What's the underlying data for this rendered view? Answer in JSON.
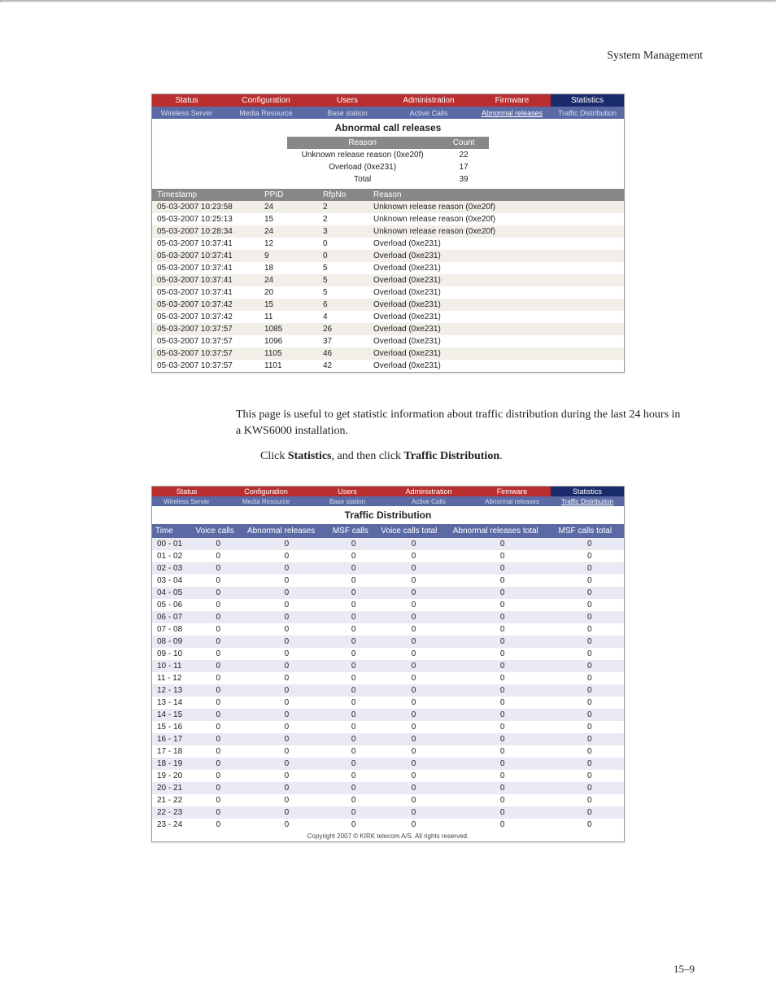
{
  "header": {
    "section": "System Management"
  },
  "shot1": {
    "tabs1": [
      "Status",
      "Configuration",
      "Users",
      "Administration",
      "Firmware",
      "Statistics"
    ],
    "tabs1_active_index": 5,
    "tabs2": [
      "Wireless Server",
      "Media Resource",
      "Base station",
      "Active Calls",
      "Abnormal releases",
      "Traffic Distribution"
    ],
    "tabs2_active_index": 4,
    "title": "Abnormal call releases",
    "sum_headers": [
      "Reason",
      "Count"
    ],
    "sum_rows": [
      [
        "Unknown release reason (0xe20f)",
        "22"
      ],
      [
        "Overload (0xe231)",
        "17"
      ],
      [
        "Total",
        "39"
      ]
    ],
    "cols": [
      "Timestamp",
      "PPID",
      "RfpNo",
      "Reason"
    ],
    "rows": [
      [
        "05-03-2007 10:23:58",
        "24",
        "2",
        "Unknown release reason (0xe20f)"
      ],
      [
        "05-03-2007 10:25:13",
        "15",
        "2",
        "Unknown release reason (0xe20f)"
      ],
      [
        "05-03-2007 10:28:34",
        "24",
        "3",
        "Unknown release reason (0xe20f)"
      ],
      [
        "05-03-2007 10:37:41",
        "12",
        "0",
        "Overload (0xe231)"
      ],
      [
        "05-03-2007 10:37:41",
        "9",
        "0",
        "Overload (0xe231)"
      ],
      [
        "05-03-2007 10:37:41",
        "18",
        "5",
        "Overload (0xe231)"
      ],
      [
        "05-03-2007 10:37:41",
        "24",
        "5",
        "Overload (0xe231)"
      ],
      [
        "05-03-2007 10:37:41",
        "20",
        "5",
        "Overload (0xe231)"
      ],
      [
        "05-03-2007 10:37:42",
        "15",
        "6",
        "Overload (0xe231)"
      ],
      [
        "05-03-2007 10:37:42",
        "11",
        "4",
        "Overload (0xe231)"
      ],
      [
        "05-03-2007 10:37:57",
        "1085",
        "26",
        "Overload (0xe231)"
      ],
      [
        "05-03-2007 10:37:57",
        "1096",
        "37",
        "Overload (0xe231)"
      ],
      [
        "05-03-2007 10:37:57",
        "1105",
        "46",
        "Overload (0xe231)"
      ],
      [
        "05-03-2007 10:37:57",
        "1101",
        "42",
        "Overload (0xe231)"
      ]
    ]
  },
  "body": {
    "para": "This page is useful to get statistic information about traffic distribution during the last 24 hours in a KWS6000 installation.",
    "step_pre": "Click ",
    "step_b1": "Statistics",
    "step_mid": ", and then click ",
    "step_b2": "Traffic Distribution",
    "step_post": "."
  },
  "shot2": {
    "tabs1": [
      "Status",
      "Configuration",
      "Users",
      "Administration",
      "Firmware",
      "Statistics"
    ],
    "tabs1_active_index": 5,
    "tabs2": [
      "Wireless Server",
      "Media Resource",
      "Base station",
      "Active Calls",
      "Abnormal releases",
      "Traffic Distribution"
    ],
    "tabs2_active_index": 5,
    "title": "Traffic Distribution",
    "cols": [
      "Time",
      "Voice calls",
      "Abnormal releases",
      "MSF calls",
      "Voice calls total",
      "Abnormal releases total",
      "MSF calls total"
    ],
    "rows": [
      [
        "00 - 01",
        "0",
        "0",
        "0",
        "0",
        "0",
        "0"
      ],
      [
        "01 - 02",
        "0",
        "0",
        "0",
        "0",
        "0",
        "0"
      ],
      [
        "02 - 03",
        "0",
        "0",
        "0",
        "0",
        "0",
        "0"
      ],
      [
        "03 - 04",
        "0",
        "0",
        "0",
        "0",
        "0",
        "0"
      ],
      [
        "04 - 05",
        "0",
        "0",
        "0",
        "0",
        "0",
        "0"
      ],
      [
        "05 - 06",
        "0",
        "0",
        "0",
        "0",
        "0",
        "0"
      ],
      [
        "06 - 07",
        "0",
        "0",
        "0",
        "0",
        "0",
        "0"
      ],
      [
        "07 - 08",
        "0",
        "0",
        "0",
        "0",
        "0",
        "0"
      ],
      [
        "08 - 09",
        "0",
        "0",
        "0",
        "0",
        "0",
        "0"
      ],
      [
        "09 - 10",
        "0",
        "0",
        "0",
        "0",
        "0",
        "0"
      ],
      [
        "10 - 11",
        "0",
        "0",
        "0",
        "0",
        "0",
        "0"
      ],
      [
        "11 - 12",
        "0",
        "0",
        "0",
        "0",
        "0",
        "0"
      ],
      [
        "12 - 13",
        "0",
        "0",
        "0",
        "0",
        "0",
        "0"
      ],
      [
        "13 - 14",
        "0",
        "0",
        "0",
        "0",
        "0",
        "0"
      ],
      [
        "14 - 15",
        "0",
        "0",
        "0",
        "0",
        "0",
        "0"
      ],
      [
        "15 - 16",
        "0",
        "0",
        "0",
        "0",
        "0",
        "0"
      ],
      [
        "16 - 17",
        "0",
        "0",
        "0",
        "0",
        "0",
        "0"
      ],
      [
        "17 - 18",
        "0",
        "0",
        "0",
        "0",
        "0",
        "0"
      ],
      [
        "18 - 19",
        "0",
        "0",
        "0",
        "0",
        "0",
        "0"
      ],
      [
        "19 - 20",
        "0",
        "0",
        "0",
        "0",
        "0",
        "0"
      ],
      [
        "20 - 21",
        "0",
        "0",
        "0",
        "0",
        "0",
        "0"
      ],
      [
        "21 - 22",
        "0",
        "0",
        "0",
        "0",
        "0",
        "0"
      ],
      [
        "22 - 23",
        "0",
        "0",
        "0",
        "0",
        "0",
        "0"
      ],
      [
        "23 - 24",
        "0",
        "0",
        "0",
        "0",
        "0",
        "0"
      ]
    ],
    "copyright": "Copyright 2007 © KIRK telecom A/S. All rights reserved."
  },
  "pagenum": "15–9"
}
